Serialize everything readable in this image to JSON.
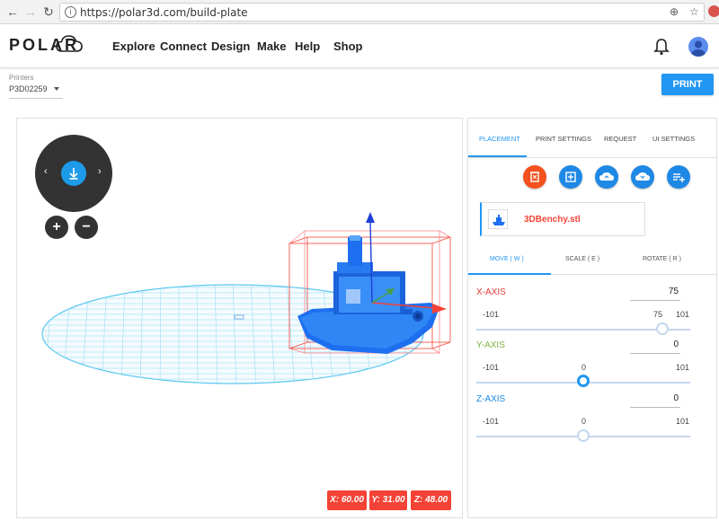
{
  "browser": {
    "url": "https://polar3d.com/build-plate"
  },
  "header": {
    "logo_text": "POLAR",
    "nav": [
      "Explore",
      "Connect",
      "Design",
      "Make",
      "Help",
      "Shop"
    ]
  },
  "toolbar": {
    "printers_label": "Printers",
    "printer_selected": "P3D02259",
    "print_label": "PRINT"
  },
  "viewport": {
    "coords": {
      "x": "X: 60.00",
      "y": "Y: 31.00",
      "z": "Z: 48.00"
    }
  },
  "panel": {
    "tabs": [
      "PLACEMENT",
      "PRINT SETTINGS",
      "REQUEST",
      "UI SETTINGS"
    ],
    "active_tab": "PLACEMENT",
    "file_name": "3DBenchy.stl",
    "subtabs": [
      "MOVE ( W )",
      "SCALE ( E )",
      "ROTATE ( R )"
    ],
    "active_subtab": "MOVE ( W )",
    "axes": [
      {
        "label": "X-AXIS",
        "value": "75",
        "min": "-101",
        "current": "75",
        "max": "101",
        "color": "#e53935",
        "fraction": 0.871
      },
      {
        "label": "Y-AXIS",
        "value": "0",
        "min": "-101",
        "current": "0",
        "max": "101",
        "color": "#7cb342",
        "fraction": 0.5
      },
      {
        "label": "Z-AXIS",
        "value": "0",
        "min": "-101",
        "current": "0",
        "max": "101",
        "color": "#1e88e5",
        "fraction": 0.5
      }
    ]
  },
  "colors": {
    "accent": "#2196f3",
    "danger": "#f44336",
    "model": "#1e6ff0",
    "grid": "#5bc8f0"
  }
}
